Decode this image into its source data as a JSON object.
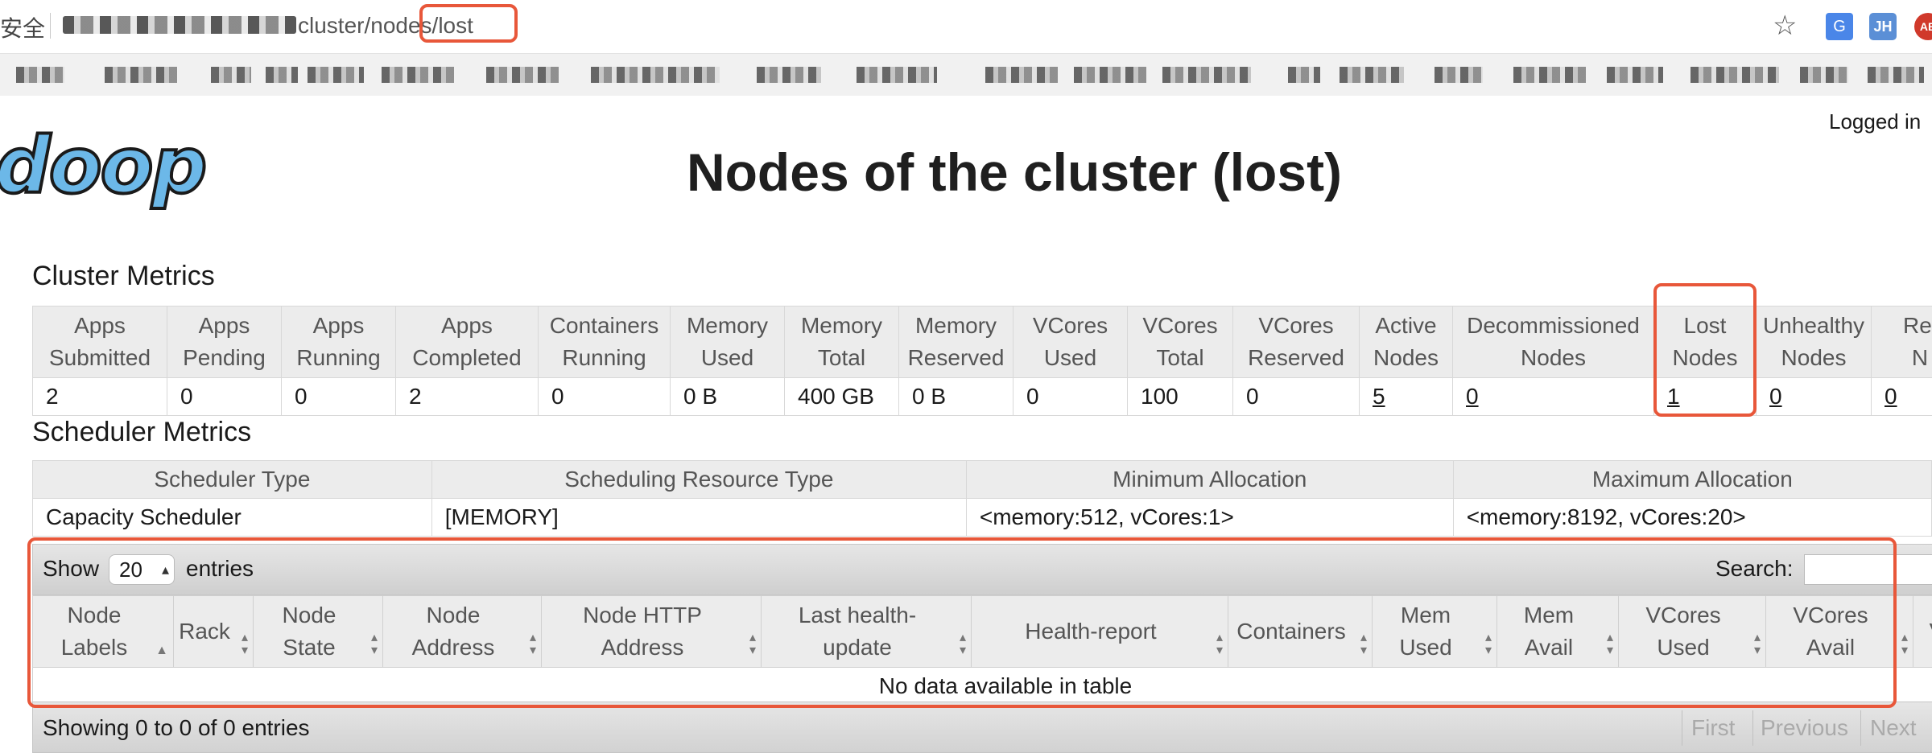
{
  "browser": {
    "security_label": "安全",
    "url_path": "cluster/nodes/lost",
    "icons": [
      "star-icon",
      "translate-icon",
      "jh-extension-icon",
      "adblock-icon"
    ],
    "jh_label": "JH",
    "abp_label": "AB"
  },
  "header": {
    "logo_text": "doop",
    "logged_in": "Logged in",
    "title": "Nodes of the cluster (lost)"
  },
  "cluster_metrics": {
    "title": "Cluster Metrics",
    "columns": [
      [
        "Apps",
        "Submitted"
      ],
      [
        "Apps",
        "Pending"
      ],
      [
        "Apps",
        "Running"
      ],
      [
        "Apps",
        "Completed"
      ],
      [
        "Containers",
        "Running"
      ],
      [
        "Memory",
        "Used"
      ],
      [
        "Memory",
        "Total"
      ],
      [
        "Memory",
        "Reserved"
      ],
      [
        "VCores",
        "Used"
      ],
      [
        "VCores",
        "Total"
      ],
      [
        "VCores",
        "Reserved"
      ],
      [
        "Active",
        "Nodes"
      ],
      [
        "Decommissioned",
        "Nodes"
      ],
      [
        "Lost",
        "Nodes"
      ],
      [
        "Unhealthy",
        "Nodes"
      ],
      [
        "Rel",
        "N"
      ]
    ],
    "values": [
      "2",
      "0",
      "0",
      "2",
      "0",
      "0 B",
      "400 GB",
      "0 B",
      "0",
      "100",
      "0",
      "5",
      "0",
      "1",
      "0",
      "0"
    ]
  },
  "scheduler_metrics": {
    "title": "Scheduler Metrics",
    "columns": [
      "Scheduler Type",
      "Scheduling Resource Type",
      "Minimum Allocation",
      "Maximum Allocation"
    ],
    "values": [
      "Capacity Scheduler",
      "[MEMORY]",
      "<memory:512, vCores:1>",
      "<memory:8192, vCores:20>"
    ]
  },
  "nodes_table": {
    "show_label": "Show",
    "page_length": "20",
    "entries_label": "entries",
    "search_label": "Search:",
    "columns": [
      [
        "Node",
        "Labels"
      ],
      [
        "Rack",
        ""
      ],
      [
        "Node",
        "State"
      ],
      [
        "Node",
        "Address"
      ],
      [
        "Node HTTP",
        "Address"
      ],
      [
        "Last health-",
        "update"
      ],
      [
        "Health-report",
        ""
      ],
      [
        "Containers",
        ""
      ],
      [
        "Mem",
        "Used"
      ],
      [
        "Mem",
        "Avail"
      ],
      [
        "VCores",
        "Used"
      ],
      [
        "VCores",
        "Avail"
      ],
      [
        "V",
        ""
      ]
    ],
    "empty_message": "No data available in table",
    "info": "Showing 0 to 0 of 0 entries",
    "pagination": {
      "first": "First",
      "previous": "Previous",
      "next": "Next"
    }
  },
  "colors": {
    "callout": "#e8573a",
    "logo": "#6cb8e8",
    "header_bg": "#ececec"
  }
}
